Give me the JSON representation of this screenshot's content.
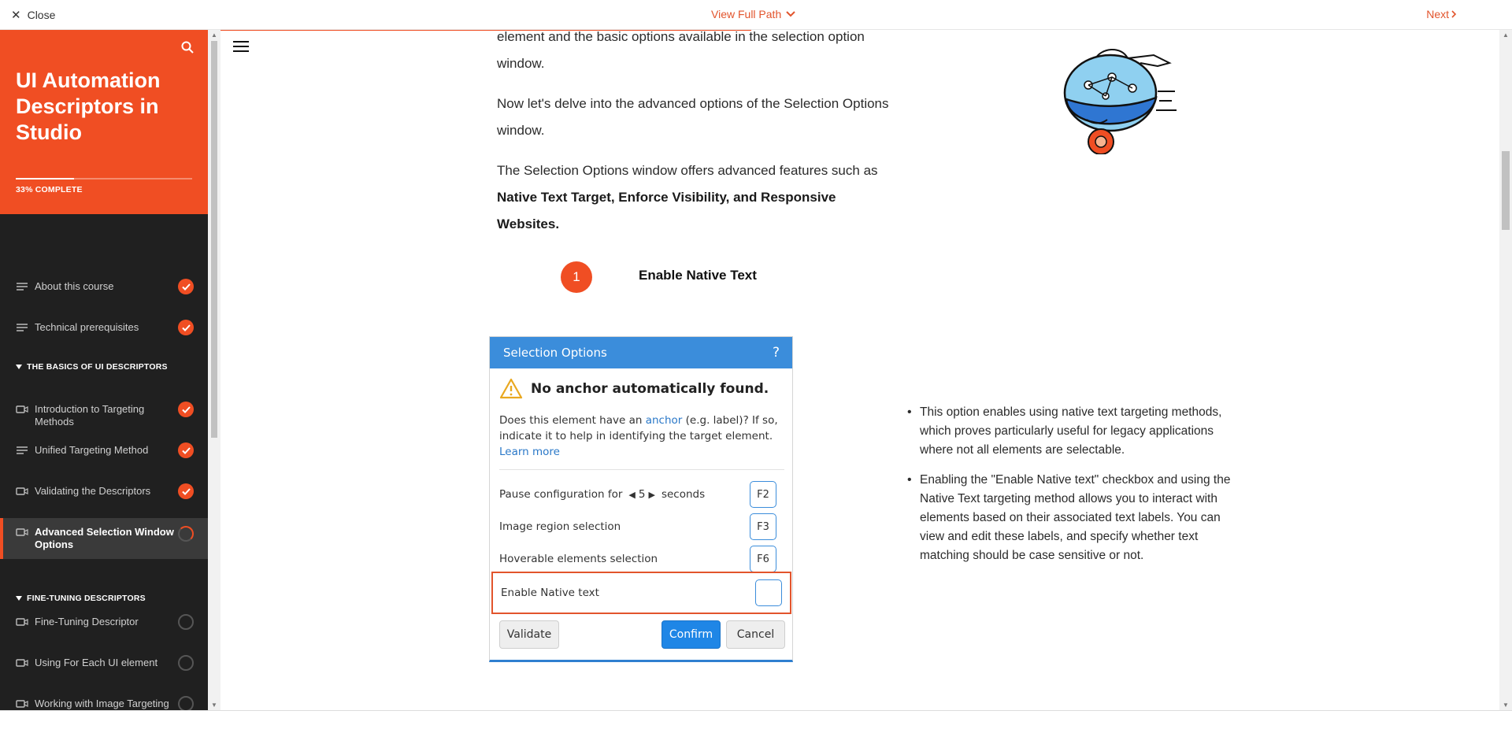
{
  "topbar": {
    "close_label": "Close",
    "view_full_path_label": "View Full Path",
    "next_label": "Next"
  },
  "sidebar": {
    "course_title": "UI Automation Descriptors in Studio",
    "progress_label": "33% COMPLETE",
    "progress_fraction": 0.33,
    "items": [
      {
        "label": "About this course",
        "icon": "text-lines-icon",
        "status": "complete"
      },
      {
        "label": "Technical prerequisites",
        "icon": "text-lines-icon",
        "status": "complete"
      },
      {
        "label": "Introduction to Targeting Methods",
        "icon": "video-icon",
        "status": "complete"
      },
      {
        "label": "Unified Targeting Method",
        "icon": "text-lines-icon",
        "status": "complete"
      },
      {
        "label": "Validating the Descriptors",
        "icon": "video-icon",
        "status": "complete"
      },
      {
        "label": "Advanced Selection Window Options",
        "icon": "video-icon",
        "status": "in-progress"
      },
      {
        "label": "Fine-Tuning Descriptor",
        "icon": "video-icon",
        "status": "not-started"
      },
      {
        "label": "Using For Each UI element",
        "icon": "video-icon",
        "status": "not-started"
      },
      {
        "label": "Working with Image Targeting method",
        "icon": "video-icon",
        "status": "not-started"
      }
    ],
    "sections": [
      {
        "label": "THE BASICS OF UI DESCRIPTORS"
      },
      {
        "label": "FINE-TUNING DESCRIPTORS"
      }
    ]
  },
  "content": {
    "para1": "element and the basic options available in the selection option window.",
    "para2": "Now let's delve into the advanced options of the Selection Options window.",
    "para3_prefix": "The Selection Options window offers advanced features such as",
    "para3_bold": "Native Text Target, Enforce Visibility, and Responsive Websites.",
    "step_number": "1",
    "step_title": "Enable Native Text",
    "bullets": [
      "This option enables using native text targeting methods, which proves particularly useful for legacy applications where not all elements are selectable.",
      "Enabling the \"Enable Native text\" checkbox and using the Native Text targeting method allows you to interact with elements based on their associated text labels. You can view and edit these labels, and specify whether text matching should be case sensitive or not."
    ]
  },
  "dialog": {
    "title": "Selection Options",
    "help": "?",
    "warning": "No anchor automatically found.",
    "desc_before": "Does this element have an",
    "desc_link": "anchor",
    "desc_after": "(e.g. label)? If so, indicate it to help in identifying the target element.",
    "learn_more": "Learn more",
    "pause_label": "Pause configuration for",
    "pause_value": "5",
    "pause_unit": "seconds",
    "pause_key": "F2",
    "image_region_label": "Image region selection",
    "image_region_key": "F3",
    "hoverable_label": "Hoverable elements selection",
    "hoverable_key": "F6",
    "native_text_label": "Enable Native text",
    "validate_label": "Validate",
    "confirm_label": "Confirm",
    "cancel_label": "Cancel"
  },
  "colors": {
    "accent": "#f04e23",
    "sidebar_bg": "#202020",
    "dialog_header": "#3b8ddb",
    "confirm_button": "#1f86e6"
  }
}
